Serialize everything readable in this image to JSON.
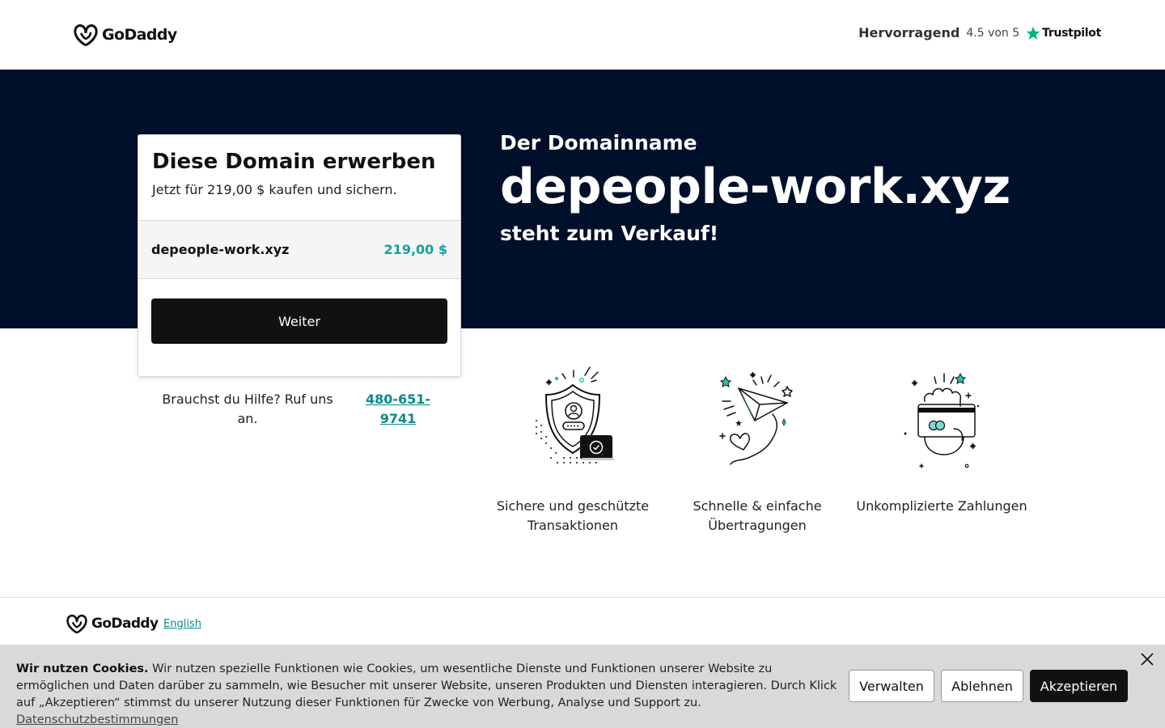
{
  "header": {
    "brand": "GoDaddy",
    "trustpilot": {
      "label": "Hervorragend",
      "score": "4.5 von 5",
      "brand": "Trustpilot"
    }
  },
  "hero": {
    "eyebrow": "Der Domainname",
    "domain": "depeople-work.xyz",
    "subtitle": "steht zum Verkauf!"
  },
  "card": {
    "title": "Diese Domain erwerben",
    "subtitle": "Jetzt für 219,00 $ kaufen und sichern.",
    "row_domain": "depeople-work.xyz",
    "row_price": "219,00 $",
    "button_label": "Weiter"
  },
  "help": {
    "text": "Brauchst du Hilfe? Ruf uns an.",
    "phone": "480-651-9741"
  },
  "features": [
    {
      "label": "Sichere und geschützte Transaktionen",
      "icon": "shield-icon"
    },
    {
      "label": "Schnelle & einfache Übertragungen",
      "icon": "paper-plane-icon"
    },
    {
      "label": "Unkomplizierte Zahlungen",
      "icon": "credit-card-hand-icon"
    }
  ],
  "footer": {
    "brand": "GoDaddy",
    "language_link": "English"
  },
  "cookie": {
    "heading": "Wir nutzen Cookies.",
    "body": " Wir nutzen spezielle Funktionen wie Cookies, um wesentliche Dienste und Funktionen unserer Website zu ermöglichen und Daten darüber zu sammeln, wie Besucher mit unserer Website, unseren Produkten und Diensten interagieren. Durch Klick auf „Akzeptieren“ stimmst du unserer Nutzung dieser Funktionen für Zwecke von Werbung, Analyse und Support zu. ",
    "policy_link": "Datenschutzbestimmungen",
    "manage_label": "Verwalten",
    "decline_label": "Ablehnen",
    "accept_label": "Akzeptieren"
  },
  "colors": {
    "hero_bg": "#000f2a",
    "accent_teal": "#13a19b",
    "button_dark": "#111111",
    "cookie_bg": "#d9d9d9"
  }
}
